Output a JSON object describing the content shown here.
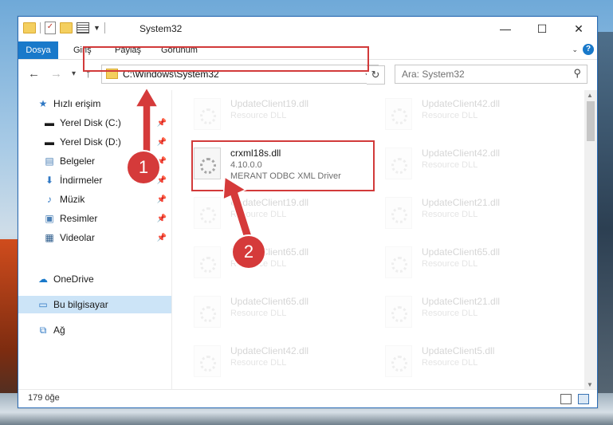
{
  "window": {
    "title": "System32",
    "controls": {
      "minimize": "—",
      "maximize": "☐",
      "close": "✕"
    }
  },
  "ribbon": {
    "tabs": [
      "Dosya",
      "Giriş",
      "Paylaş",
      "Görünüm"
    ],
    "help": "?"
  },
  "navigation": {
    "address_path": "C:\\Windows\\System32",
    "search_placeholder": "Ara: System32"
  },
  "sidebar": {
    "items": [
      {
        "label": "Hızlı erişim",
        "icon": "star-icon"
      },
      {
        "label": "Yerel Disk (C:)",
        "icon": "drive-icon"
      },
      {
        "label": "Yerel Disk (D:)",
        "icon": "drive-icon"
      },
      {
        "label": "Belgeler",
        "icon": "documents-icon"
      },
      {
        "label": "İndirmeler",
        "icon": "download-icon"
      },
      {
        "label": "Müzik",
        "icon": "music-icon"
      },
      {
        "label": "Resimler",
        "icon": "pictures-icon"
      },
      {
        "label": "Videolar",
        "icon": "videos-icon"
      },
      {
        "label": "OneDrive",
        "icon": "cloud-icon"
      },
      {
        "label": "Bu bilgisayar",
        "icon": "computer-icon"
      },
      {
        "label": "Ağ",
        "icon": "network-icon"
      }
    ]
  },
  "files": {
    "highlighted": {
      "name": "crxml18s.dll",
      "version": "4.10.0.0",
      "description": "MERANT ODBC XML Driver"
    },
    "background": [
      {
        "name": "UpdateClient19.dll",
        "desc": "Resource DLL"
      },
      {
        "name": "UpdateClient42.dll",
        "desc": "Resource DLL"
      },
      {
        "name": "UpdateClient42.dll",
        "desc": "Resource DLL"
      },
      {
        "name": "UpdateClient19.dll",
        "desc": "Resource DLL"
      },
      {
        "name": "UpdateClient21.dll",
        "desc": "Resource DLL"
      },
      {
        "name": "UpdateClient65.dll",
        "desc": "Resource DLL"
      },
      {
        "name": "UpdateClient65.dll",
        "desc": "Resource DLL"
      },
      {
        "name": "UpdateClient65.dll",
        "desc": "Resource DLL"
      },
      {
        "name": "UpdateClient21.dll",
        "desc": "Resource DLL"
      },
      {
        "name": "UpdateClient42.dll",
        "desc": "Resource DLL"
      },
      {
        "name": "UpdateClient5.dll",
        "desc": "Resource DLL"
      }
    ]
  },
  "status": {
    "item_count": "179 öğe"
  },
  "annotations": {
    "badge1": "1",
    "badge2": "2",
    "accent_color": "#d23a3a"
  }
}
